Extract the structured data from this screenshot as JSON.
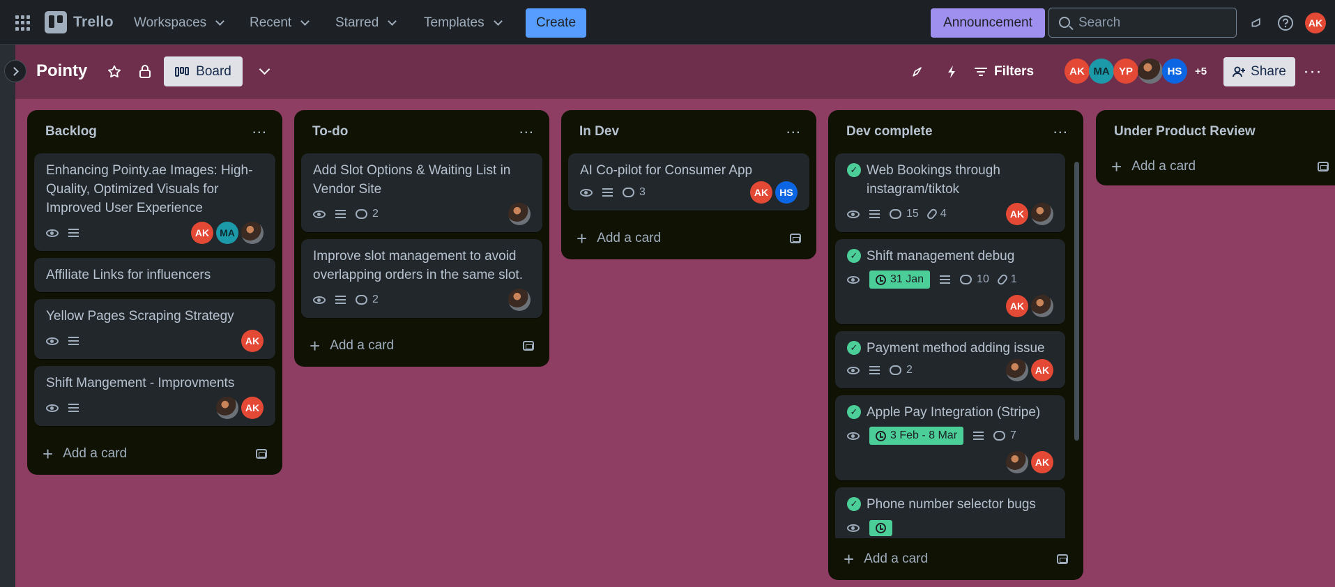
{
  "app": {
    "name": "Trello",
    "brand_color": "#579dff",
    "board_bg": "#8e3e63"
  },
  "nav": {
    "menus": [
      {
        "label": "Workspaces"
      },
      {
        "label": "Recent"
      },
      {
        "label": "Starred"
      },
      {
        "label": "Templates"
      }
    ],
    "create_label": "Create",
    "announcement_label": "Announcement",
    "search_placeholder": "Search",
    "user_initials": "AK"
  },
  "board": {
    "title": "Pointy",
    "view_label": "Board",
    "filters_label": "Filters",
    "members": [
      "AK",
      "MA",
      "YP",
      "",
      "HS"
    ],
    "extra_members": "+5",
    "share_label": "Share"
  },
  "lists": [
    {
      "title": "Backlog",
      "add_label": "Add a card",
      "cards": [
        {
          "title": "Enhancing Pointy.ae Images: High-Quality, Optimized Visuals for Improved User Experience",
          "members": [
            "AK",
            "MA",
            ""
          ]
        },
        {
          "title": "Affiliate Links for influencers"
        },
        {
          "title": "Yellow Pages Scraping Strategy",
          "members": [
            "AK"
          ]
        },
        {
          "title": "Shift Mangement - Improvments",
          "members": [
            "",
            "AK"
          ]
        }
      ]
    },
    {
      "title": "To-do",
      "add_label": "Add a card",
      "cards": [
        {
          "title": "Add Slot Options & Waiting List in Vendor Site",
          "comments": "2"
        },
        {
          "title": "Improve slot management to avoid overlapping orders in the same slot.",
          "comments": "2"
        }
      ]
    },
    {
      "title": "In Dev",
      "add_label": "Add a card",
      "cards": [
        {
          "title": "AI Co-pilot for Consumer App",
          "comments": "3",
          "members": [
            "AK",
            "HS"
          ]
        }
      ]
    },
    {
      "title": "Dev complete",
      "add_label": "Add a card",
      "cards": [
        {
          "title": "Web Bookings through instagram/tiktok",
          "comments": "15",
          "attachments": "4"
        },
        {
          "title": "Shift management debug",
          "date": "31 Jan",
          "comments": "10",
          "attachments": "1"
        },
        {
          "title": "Payment method adding issue",
          "comments": "2"
        },
        {
          "title": "Apple Pay Integration (Stripe)",
          "date": "3 Feb - 8 Mar",
          "comments": "7"
        },
        {
          "title": "Phone number selector bugs"
        }
      ]
    },
    {
      "title": "Under Product Review",
      "add_label": "Add a card",
      "cards": []
    }
  ]
}
